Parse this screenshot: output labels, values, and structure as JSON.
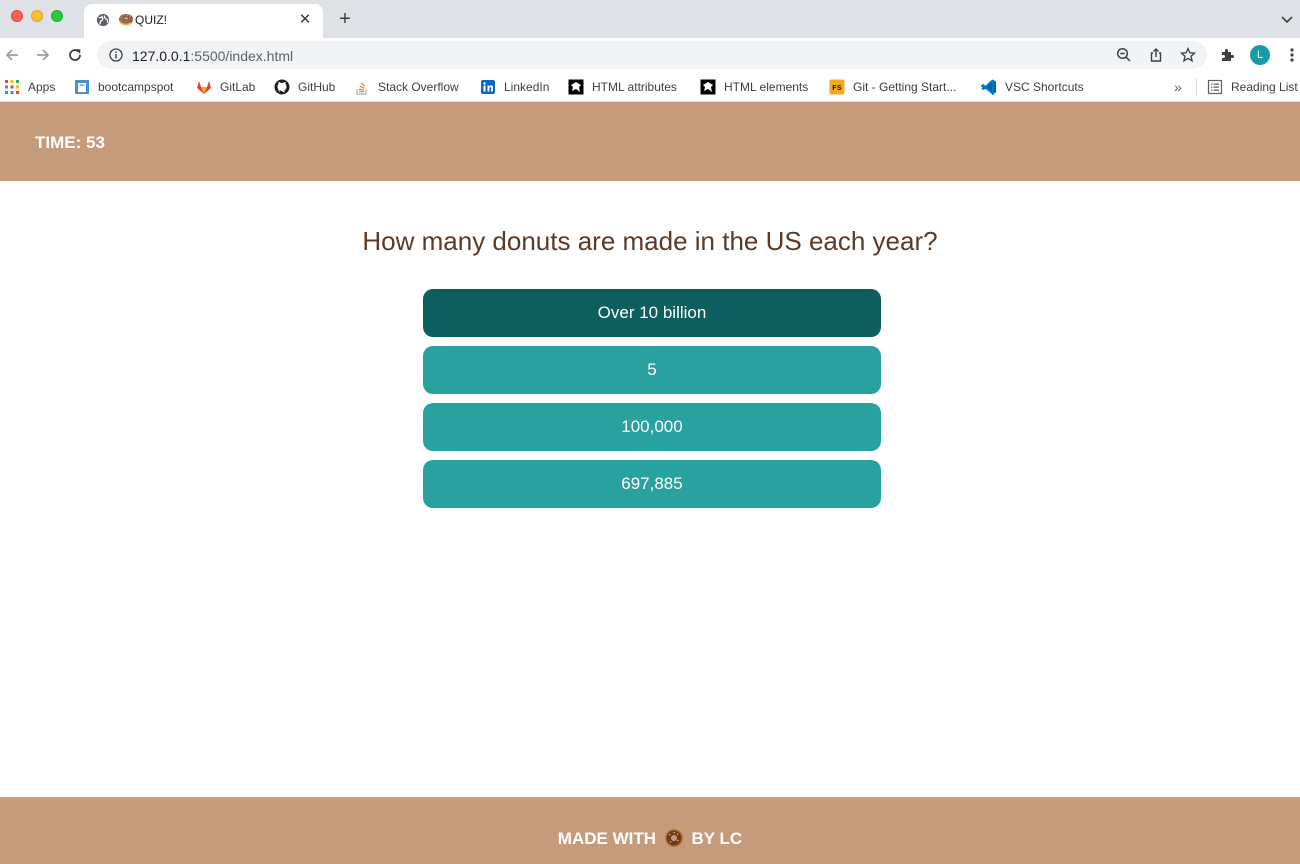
{
  "browser": {
    "tab": {
      "emoji": "🍩",
      "title": "QUIZ!"
    },
    "url": {
      "host": "127.0.0.1",
      "path": ":5500/index.html"
    },
    "profile_initial": "L",
    "bookmarks": [
      {
        "label": "Apps",
        "icon": "apps-grid-icon"
      },
      {
        "label": "bootcampspot",
        "icon": "bootcampspot-icon"
      },
      {
        "label": "GitLab",
        "icon": "gitlab-icon"
      },
      {
        "label": "GitHub",
        "icon": "github-icon"
      },
      {
        "label": "Stack Overflow",
        "icon": "stackoverflow-icon"
      },
      {
        "label": "LinkedIn",
        "icon": "linkedin-icon"
      },
      {
        "label": "HTML attributes",
        "icon": "devdocs-icon"
      },
      {
        "label": "HTML elements",
        "icon": "devdocs-icon"
      },
      {
        "label": "Git - Getting Start...",
        "icon": "git-fs-icon"
      },
      {
        "label": "VSC Shortcuts",
        "icon": "vscode-icon"
      }
    ],
    "more": "»",
    "reading_list": "Reading List"
  },
  "quiz": {
    "timer": "TIME: 53",
    "question": "How many donuts are made in the US each year?",
    "answers": [
      "Over 10 billion",
      "5",
      "100,000",
      "697,885"
    ],
    "selected_index": 0
  },
  "footer": {
    "before": "MADE WITH",
    "after": "BY LC"
  },
  "colors": {
    "header_bg": "#c69b7b",
    "question_text": "#5b3a29",
    "answer_bg": "#29a19f",
    "answer_selected_bg": "#0d5e5e"
  }
}
